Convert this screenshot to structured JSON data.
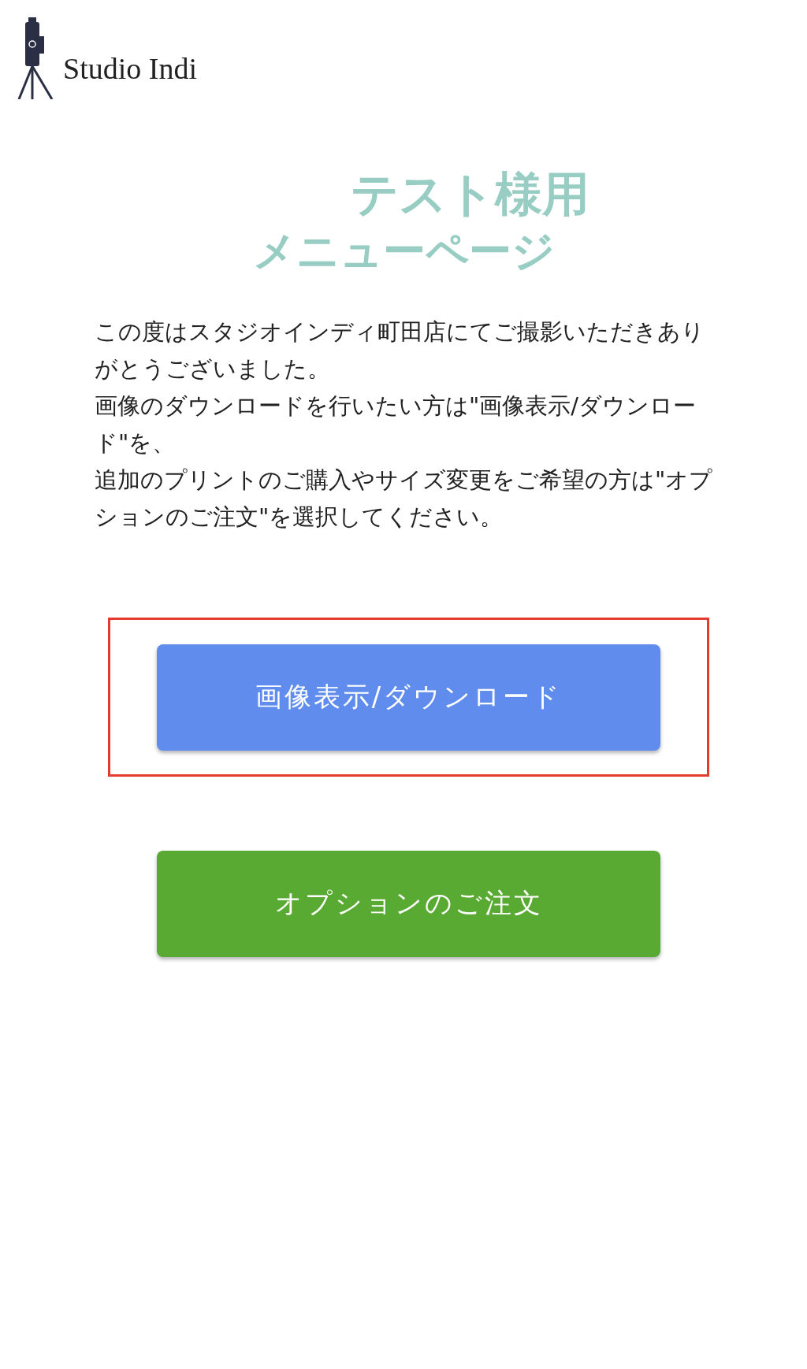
{
  "logo": {
    "text": "Studio Indi"
  },
  "title": {
    "line_1": "テスト様用",
    "line_2": "メニューページ"
  },
  "message": [
    "この度はスタジオインディ町田店にてご撮影いただきありがとうございました。",
    "画像のダウンロードを行いたい方は\"画像表示/ダウンロード\"を、",
    "追加のプリントのご購入やサイズ変更をご希望の方は\"オプションのご注文\"を選択してください。"
  ],
  "buttons": [
    {
      "label": "画像表示/ダウンロード",
      "color": "#5f8ced",
      "highlighted": true
    },
    {
      "label": "オプションのご注文",
      "color": "#58aa32",
      "highlighted": false
    }
  ]
}
